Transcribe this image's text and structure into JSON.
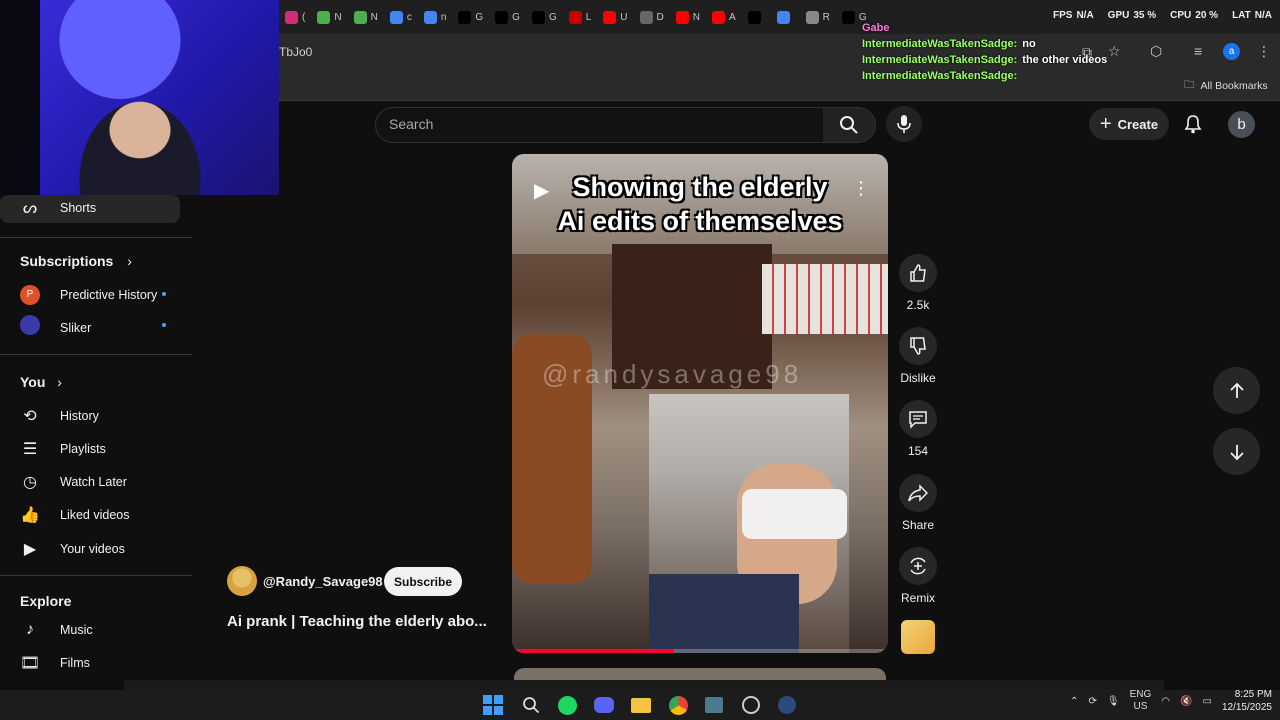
{
  "browser": {
    "tabs": [
      {
        "icon": "instagram-icon",
        "label": "(",
        "color": "#d62976"
      },
      {
        "icon": "chart-icon",
        "label": "N",
        "color": "#4caf50"
      },
      {
        "icon": "chart-icon",
        "label": "N",
        "color": "#4caf50"
      },
      {
        "icon": "google-icon",
        "label": "c",
        "color": "#4285f4"
      },
      {
        "icon": "google-icon",
        "label": "n",
        "color": "#4285f4"
      },
      {
        "icon": "x-icon",
        "label": "G",
        "color": "#000000"
      },
      {
        "icon": "x-icon",
        "label": "G",
        "color": "#000000"
      },
      {
        "icon": "x-icon",
        "label": "G",
        "color": "#000000"
      },
      {
        "icon": "cnn-icon",
        "label": "L",
        "color": "#cc0000"
      },
      {
        "icon": "youtube-icon",
        "label": "U",
        "color": "#ff0000"
      },
      {
        "icon": "building-icon",
        "label": "D",
        "color": "#666666"
      },
      {
        "icon": "youtube-icon",
        "label": "N",
        "color": "#ff0000"
      },
      {
        "icon": "youtube-icon",
        "label": "A",
        "color": "#ff0000"
      },
      {
        "icon": "x-icon",
        "label": "",
        "color": "#000000"
      },
      {
        "icon": "google-icon",
        "label": "",
        "color": "#4285f4"
      },
      {
        "icon": "refresh-icon",
        "label": "R",
        "color": "#888888"
      },
      {
        "icon": "x-icon",
        "label": "G",
        "color": "#000000"
      }
    ],
    "url_text": "TbJo0",
    "bookmarks_label": "All Bookmarks"
  },
  "overlay": {
    "stats": [
      {
        "label": "FPS",
        "value": "N/A"
      },
      {
        "label": "GPU",
        "value": "35 %"
      },
      {
        "label": "CPU",
        "value": "20 %"
      },
      {
        "label": "LAT",
        "value": "N/A"
      }
    ],
    "chat": [
      {
        "user": "Gabe",
        "message": ""
      },
      {
        "user": "IntermediateWasTakenSadge:",
        "message": "no"
      },
      {
        "user": "IntermediateWasTakenSadge:",
        "message": "the other videos"
      },
      {
        "user": "IntermediateWasTakenSadge:",
        "message": ""
      }
    ]
  },
  "sidebar": {
    "shorts_label": "Shorts",
    "subscriptions_heading": "Subscriptions",
    "subscriptions": [
      {
        "label": "Predictive History",
        "avatar_letter": "P",
        "color": "#e0502a"
      },
      {
        "label": "Sliker",
        "avatar_letter": "",
        "color": "#3a3aa8"
      }
    ],
    "you_heading": "You",
    "you_items": [
      {
        "label": "History",
        "icon": "history-icon",
        "glyph": "⟲"
      },
      {
        "label": "Playlists",
        "icon": "playlists-icon",
        "glyph": "☰"
      },
      {
        "label": "Watch Later",
        "icon": "clock-icon",
        "glyph": "◷"
      },
      {
        "label": "Liked videos",
        "icon": "thumbs-up-icon",
        "glyph": "👍"
      },
      {
        "label": "Your videos",
        "icon": "video-icon",
        "glyph": "▶"
      }
    ],
    "explore_heading": "Explore",
    "explore_items": [
      {
        "label": "Music",
        "icon": "music-icon",
        "glyph": "♪"
      },
      {
        "label": "Films",
        "icon": "film-icon",
        "glyph": "🎞"
      }
    ]
  },
  "header": {
    "search_placeholder": "Search",
    "create_label": "Create",
    "avatar_letter": "b"
  },
  "video": {
    "overlay_title_line1": "Showing the elderly",
    "overlay_title_line2": "Ai edits of themselves",
    "watermark": "@randysavage98",
    "progress_fraction": 0.43,
    "channel_name": "@Randy_Savage98",
    "subscribe_label": "Subscribe",
    "title": "Ai prank | Teaching the elderly abo..."
  },
  "actions": {
    "like_count": "2.5k",
    "dislike_label": "Dislike",
    "comment_count": "154",
    "share_label": "Share",
    "remix_label": "Remix"
  },
  "taskbar": {
    "lang_line1": "ENG",
    "lang_line2": "US",
    "time": "8:25 PM",
    "date": "12/15/2025"
  }
}
